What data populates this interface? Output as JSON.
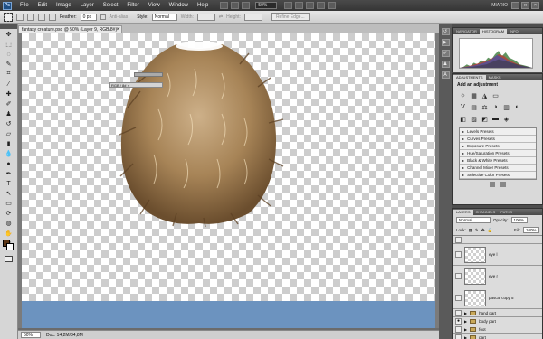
{
  "menubar": {
    "logo": "Ps",
    "items": [
      "File",
      "Edit",
      "Image",
      "Layer",
      "Select",
      "Filter",
      "View",
      "Window",
      "Help"
    ],
    "zoom": "50%",
    "workspace": "MIARIO",
    "win_min": "–",
    "win_max": "□",
    "win_close": "×"
  },
  "options": {
    "feather_label": "Feather:",
    "feather_value": "0 px",
    "antialias_label": "Anti-alias",
    "style_label": "Style:",
    "style_value": "Normal",
    "width_label": "Width:",
    "height_label": "Height:",
    "refine_label": "Refine Edge..."
  },
  "document": {
    "tab_title": "fantasy creature.psd @ 50% (Layer 9, RGB/8#) *",
    "tab_close": "×",
    "float_label": "RGB / 8# ×",
    "zoom": "50%",
    "doc_size": "Doc: 14,2M/84,8M"
  },
  "panels": {
    "top_tabs": [
      "NAVIGATOR",
      "HISTOGRAM",
      "INFO"
    ],
    "adj_tabs": [
      "ADJUSTMENTS",
      "MASKS"
    ],
    "adj_title": "Add an adjustment",
    "adj_icons_row1": [
      "☼",
      "▦",
      "◮",
      "▭"
    ],
    "adj_icons_row2": [
      "V",
      "▤",
      "⚖",
      "◑",
      "▥",
      "◐"
    ],
    "presets": [
      "Levels Presets",
      "Curves Presets",
      "Exposure Presets",
      "Hue/Saturation Presets",
      "Black & White Presets",
      "Channel Mixer Presets",
      "Selective Color Presets"
    ],
    "layer_tabs": [
      "LAYERS",
      "CHANNELS",
      "PATHS"
    ],
    "blend_mode": "Normal",
    "opacity_label": "Opacity:",
    "opacity_value": "100%",
    "lock_label": "Lock:",
    "fill_label": "Fill:",
    "fill_value": "100%",
    "layers": [
      {
        "name": "eye l"
      },
      {
        "name": "eye r"
      },
      {
        "name": "pascal copy 5"
      }
    ],
    "groups": [
      {
        "name": "hand part",
        "visible": false
      },
      {
        "name": "body part",
        "visible": true
      },
      {
        "name": "foot",
        "visible": false
      },
      {
        "name": "part",
        "visible": false
      }
    ]
  },
  "colors": {
    "foreground": "#5a3516",
    "background": "#ffffff",
    "canvas_band": "#6c93bf"
  }
}
